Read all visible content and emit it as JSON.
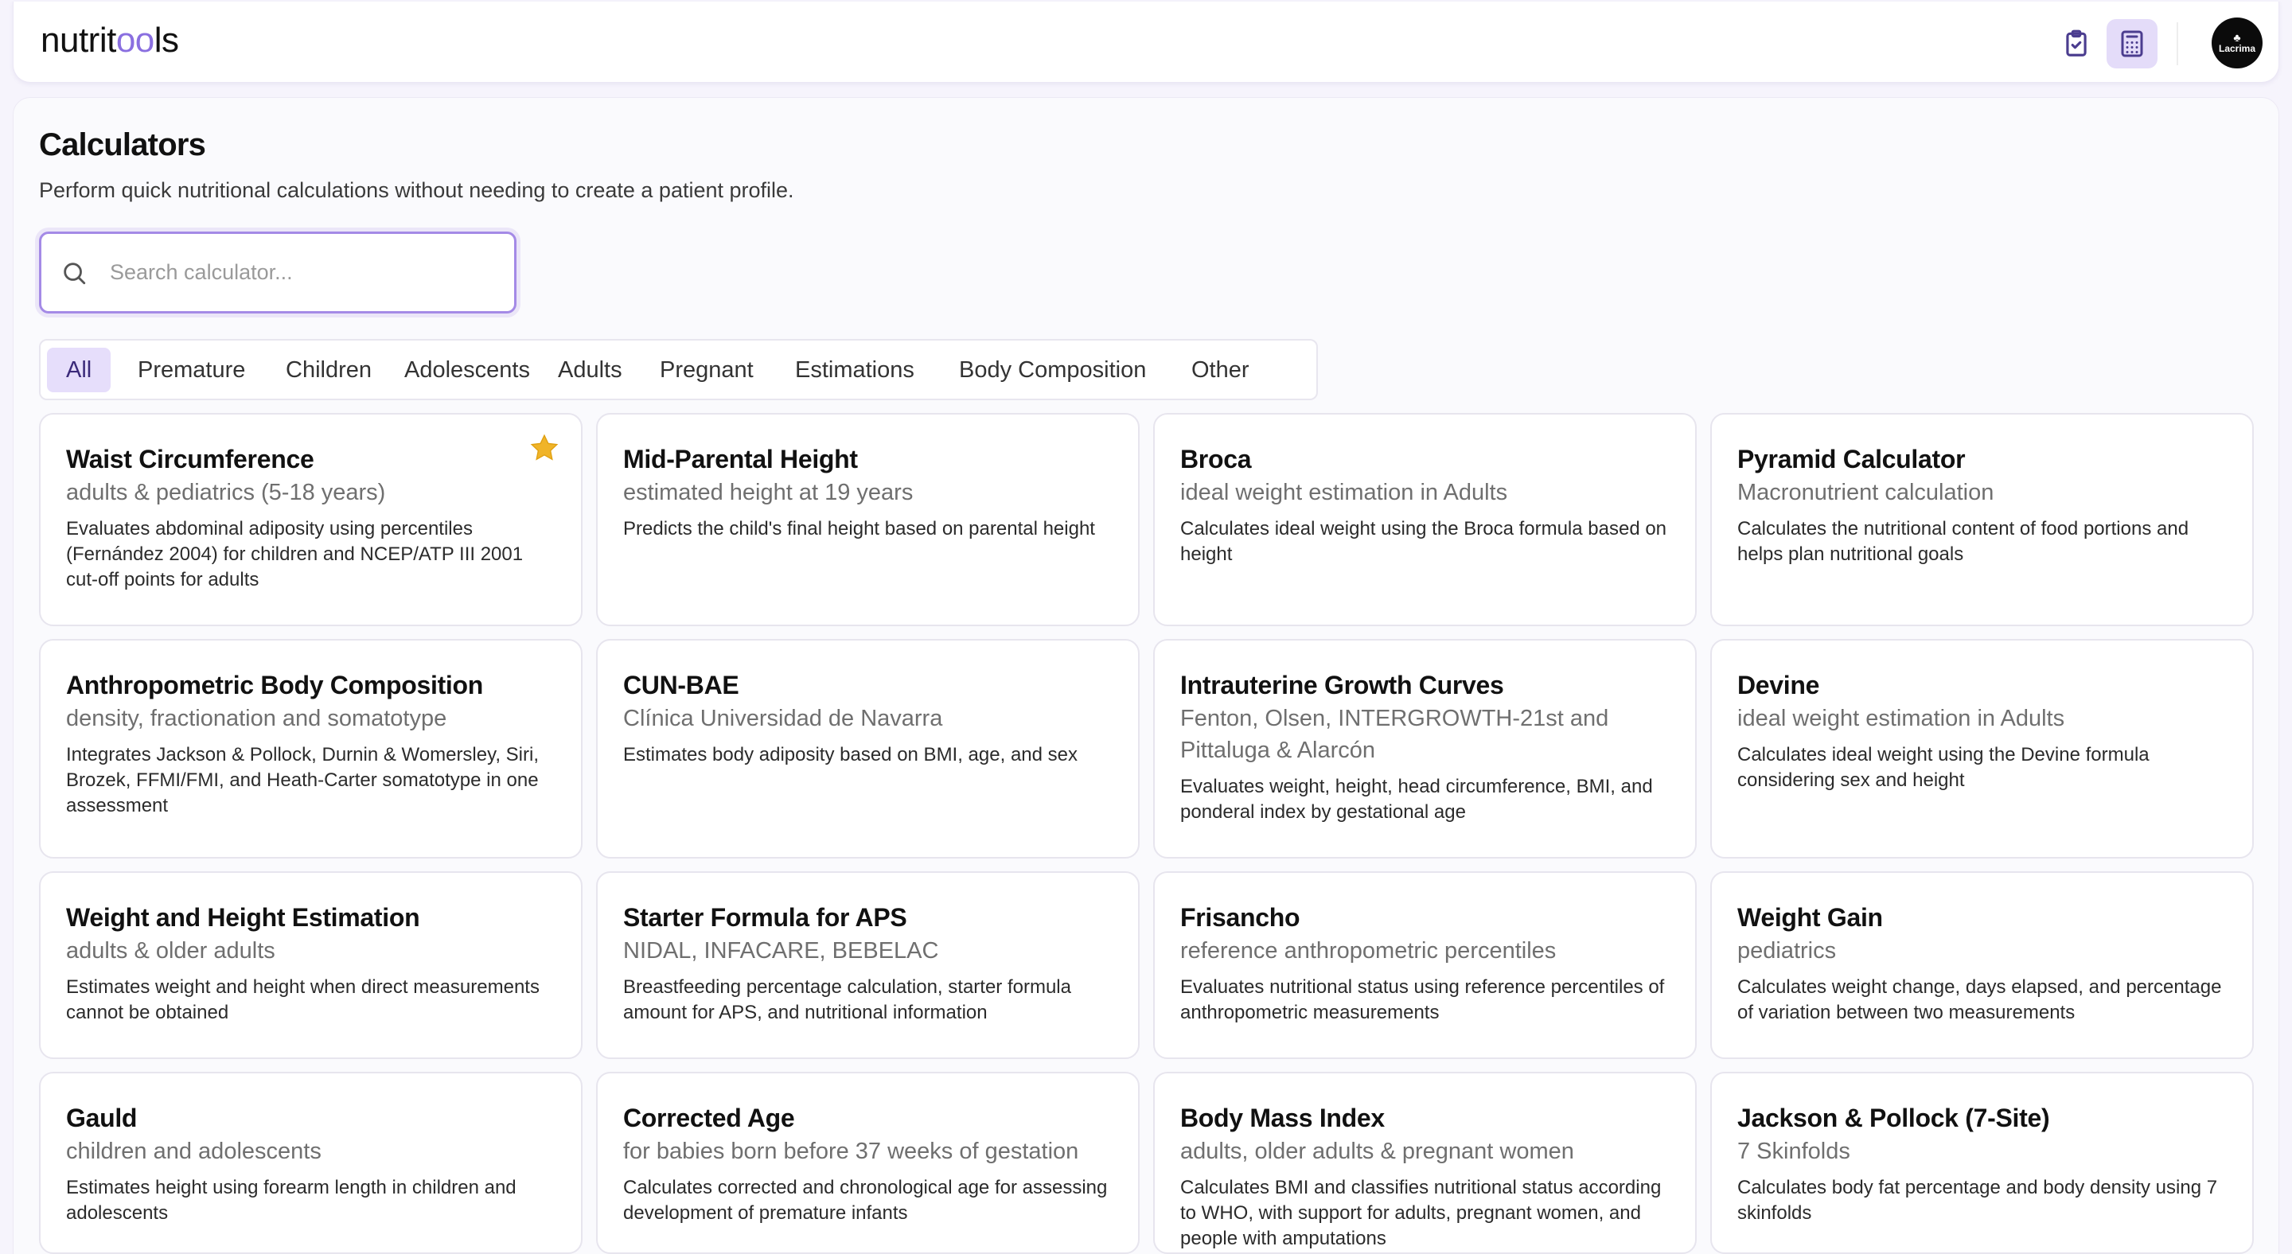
{
  "app": {
    "logo_pre": "nutrit",
    "logo_oo": "oo",
    "logo_post": "ls",
    "accent": "#8a6fe0"
  },
  "header": {
    "tasks_icon": "clipboard-check-icon",
    "calculator_icon": "calculator-icon",
    "avatar_label": "Lacrima"
  },
  "page": {
    "title": "Calculators",
    "subtitle": "Perform quick nutritional calculations without needing to create a patient profile."
  },
  "search": {
    "placeholder": "Search calculator...",
    "value": ""
  },
  "tabs": [
    "All",
    "Premature",
    "Children",
    "Adolescents",
    "Adults",
    "Pregnant",
    "Estimations",
    "Body Composition",
    "Other"
  ],
  "cards": [
    {
      "title": "Waist Circumference",
      "subtitle": "adults & pediatrics (5-18 years)",
      "desc": "Evaluates abdominal adiposity using percentiles (Fernández 2004) for children and NCEP/ATP III 2001 cut-off points for adults",
      "favorite": true
    },
    {
      "title": "Mid-Parental Height",
      "subtitle": "estimated height at 19 years",
      "desc": "Predicts the child's final height based on parental height"
    },
    {
      "title": "Broca",
      "subtitle": "ideal weight estimation in Adults",
      "desc": "Calculates ideal weight using the Broca formula based on height"
    },
    {
      "title": "Pyramid Calculator",
      "subtitle": "Macronutrient calculation",
      "desc": "Calculates the nutritional content of food portions and helps plan nutritional goals"
    },
    {
      "title": "Anthropometric Body Composition",
      "subtitle": "density, fractionation and somatotype",
      "desc": "Integrates Jackson & Pollock, Durnin & Womersley, Siri, Brozek, FFMI/FMI, and Heath-Carter somatotype in one assessment"
    },
    {
      "title": "CUN-BAE",
      "subtitle": "Clínica Universidad de Navarra",
      "desc": "Estimates body adiposity based on BMI, age, and sex"
    },
    {
      "title": "Intrauterine Growth Curves",
      "subtitle": "Fenton, Olsen, INTERGROWTH-21st and Pittaluga & Alarcón",
      "desc": "Evaluates weight, height, head circumference, BMI, and ponderal index by gestational age"
    },
    {
      "title": "Devine",
      "subtitle": "ideal weight estimation in Adults",
      "desc": "Calculates ideal weight using the Devine formula considering sex and height"
    },
    {
      "title": "Weight and Height Estimation",
      "subtitle": "adults & older adults",
      "desc": "Estimates weight and height when direct measurements cannot be obtained"
    },
    {
      "title": "Starter Formula for APS",
      "subtitle": "NIDAL, INFACARE, BEBELAC",
      "desc": "Breastfeeding percentage calculation, starter formula amount for APS, and nutritional information"
    },
    {
      "title": "Frisancho",
      "subtitle": "reference anthropometric percentiles",
      "desc": "Evaluates nutritional status using reference percentiles of anthropometric measurements"
    },
    {
      "title": "Weight Gain",
      "subtitle": "pediatrics",
      "desc": "Calculates weight change, days elapsed, and percentage of variation between two measurements"
    },
    {
      "title": "Gauld",
      "subtitle": "children and adolescents",
      "desc": "Estimates height using forearm length in children and adolescents"
    },
    {
      "title": "Corrected Age",
      "subtitle": "for babies born before 37 weeks of gestation",
      "desc": "Calculates corrected and chronological age for assessing development of premature infants"
    },
    {
      "title": "Body Mass Index",
      "subtitle": "adults, older adults & pregnant women",
      "desc": "Calculates BMI and classifies nutritional status according to WHO, with support for adults, pregnant women, and people with amputations"
    },
    {
      "title": "Jackson & Pollock (7-Site)",
      "subtitle": "7 Skinfolds",
      "desc": "Calculates body fat percentage and body density using 7 skinfolds"
    }
  ]
}
